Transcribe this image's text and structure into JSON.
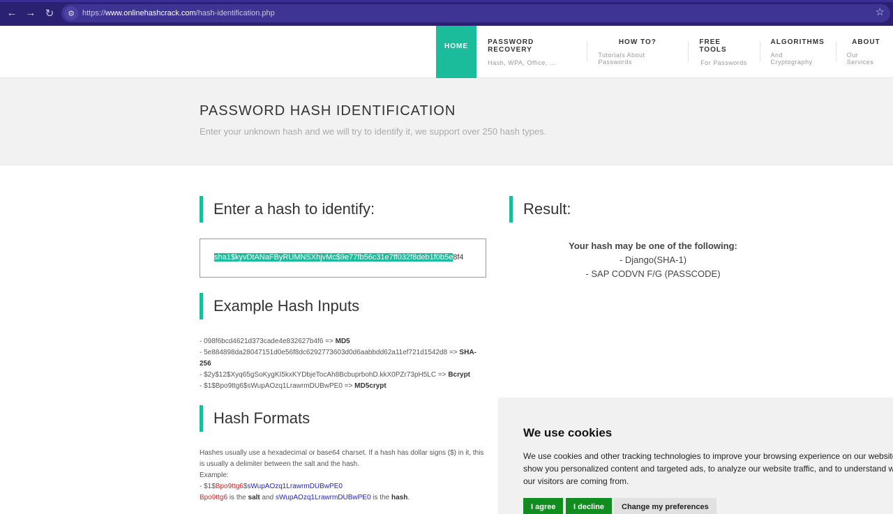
{
  "browser": {
    "url_prefix": "https://",
    "url_domain": "www.onlinehashcrack.com",
    "url_path": "/hash-identification.php"
  },
  "nav": {
    "items": [
      {
        "title": "HOME",
        "sub": ""
      },
      {
        "title": "PASSWORD RECOVERY",
        "sub": "Hash, WPA, Office, ..."
      },
      {
        "title": "HOW TO?",
        "sub": "Tutorials About Passwords"
      },
      {
        "title": "FREE TOOLS",
        "sub": "For Passwords"
      },
      {
        "title": "ALGORITHMS",
        "sub": "And Cryptography"
      },
      {
        "title": "ABOUT",
        "sub": "Our Services"
      }
    ]
  },
  "banner": {
    "title": "PASSWORD HASH IDENTIFICATION",
    "subtitle": "Enter your unknown hash and we will try to identify it, we support over 250 hash types."
  },
  "input_section": {
    "heading": "Enter a hash to identify:",
    "value_selected": "sha1$kyvDtANaFByRUMNSXhjvMc$9e77fb56c31e7ff032f8deb1f0b5e",
    "value_rest": "8f4"
  },
  "result_section": {
    "heading": "Result:",
    "intro": "Your hash may be one of the following:",
    "items": [
      "- Django(SHA-1)",
      "- SAP CODVN F/G (PASSCODE)"
    ]
  },
  "examples_section": {
    "heading": "Example Hash Inputs",
    "lines": [
      {
        "hash": "- 098f6bcd4621d373cade4e832627b4f6 => ",
        "type": "MD5"
      },
      {
        "hash": "- 5e884898da28047151d0e56f8dc6292773603d0d6aabbdd62a11ef721d1542d8 => ",
        "type": "SHA-256"
      },
      {
        "hash": "- $2y$12$Xyq65gSoKygKI5kxKYDbjeTocAh8BcbuprbohD.kkX0PZr73pH5LC => ",
        "type": "Bcrypt"
      },
      {
        "hash": "- $1$Bpo9ttg6$sWupAOzq1LrawrmDUBwPE0 => ",
        "type": "MD5crypt"
      }
    ]
  },
  "formats_section": {
    "heading": "Hash Formats",
    "para": "Hashes usually use a hexadecimal or base64 charset. If a hash has dollar signs ($) in it, this is usually a delimiter between the salt and the hash.",
    "example_label": "Example:",
    "ex_prefix": "- $1$",
    "ex_salt": "Bpo9ttg6",
    "ex_dollar": "$",
    "ex_hash": "sWupAOzq1LrawrmDUBwPE0",
    "line2_salt": "Bpo9ttg6",
    "line2_is_the": " is the ",
    "line2_salt_word": "salt",
    "line2_and": " and ",
    "line2_hash": "sWupAOzq1LrawrmDUBwPE0",
    "line2_is_the2": " is the ",
    "line2_hash_word": "hash",
    "line2_end": "."
  },
  "cookie": {
    "title": "We use cookies",
    "text": "We use cookies and other tracking technologies to improve your browsing experience on our website, to show you personalized content and targeted ads, to analyze our website traffic, and to understand where our visitors are coming from.",
    "agree": "I agree",
    "decline": "I decline",
    "prefs": "Change my preferences"
  },
  "colors": {
    "accent": "#1abc9c",
    "browser_bg": "#2a2172",
    "cookie_green": "#118c1e"
  }
}
